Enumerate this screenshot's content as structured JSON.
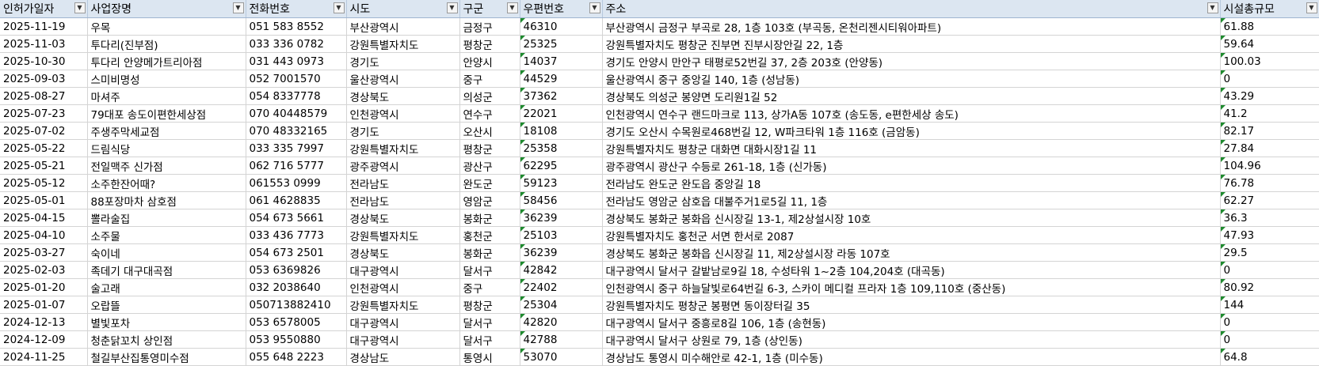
{
  "columns": [
    "인허가일자",
    "사업장명",
    "전화번호",
    "시도",
    "구군",
    "우편번호",
    "주소",
    "시설총규모"
  ],
  "rows": [
    [
      "2025-11-19",
      "우목",
      "051 583 8552",
      "부산광역시",
      "금정구",
      "46310",
      "부산광역시 금정구 부곡로 28, 1층 103호 (부곡동, 온천리젠시티워아파트)",
      "61.88"
    ],
    [
      "2025-11-03",
      "투다리(진부점)",
      "033 336 0782",
      "강원특별자치도",
      "평창군",
      "25325",
      "강원특별자치도 평창군 진부면 진부시장안길 22, 1층",
      "59.64"
    ],
    [
      "2025-10-30",
      "투다리 안양메가트리아점",
      "031 443 0973",
      "경기도",
      "안양시",
      "14037",
      "경기도 안양시 만안구 태평로52번길 37, 2층 203호 (안양동)",
      "100.03"
    ],
    [
      "2025-09-03",
      "스미비명성",
      "052 7001570",
      "울산광역시",
      "중구",
      "44529",
      "울산광역시 중구 중앙길 140, 1층 (성남동)",
      "0"
    ],
    [
      "2025-08-27",
      "마셔주",
      "054 8337778",
      "경상북도",
      "의성군",
      "37362",
      "경상북도 의성군 봉양면 도리원1길 52",
      "43.29"
    ],
    [
      "2025-07-23",
      "79대포 송도이편한세상점",
      "070 40448579",
      "인천광역시",
      "연수구",
      "22021",
      "인천광역시 연수구 랜드마크로 113, 상가A동 107호 (송도동, e편한세상 송도)",
      "41.2"
    ],
    [
      "2025-07-02",
      "주생주막세교점",
      "070 48332165",
      "경기도",
      "오산시",
      "18108",
      "경기도 오산시 수목원로468번길 12, W파크타워 1층 116호 (금암동)",
      "82.17"
    ],
    [
      "2025-05-22",
      "드림식당",
      "033 335 7997",
      "강원특별자치도",
      "평창군",
      "25358",
      "강원특별자치도 평창군 대화면 대화시장1길 11",
      "27.84"
    ],
    [
      "2025-05-21",
      "전일맥주 신가점",
      "062 716 5777",
      "광주광역시",
      "광산구",
      "62295",
      "광주광역시 광산구 수등로 261-18, 1층 (신가동)",
      "104.96"
    ],
    [
      "2025-05-12",
      "소주한잔어때?",
      "061553 0999",
      "전라남도",
      "완도군",
      "59123",
      "전라남도 완도군 완도읍 중앙길 18",
      "76.78"
    ],
    [
      "2025-05-01",
      "88포장마차 삼호점",
      "061 4628835",
      "전라남도",
      "영암군",
      "58456",
      "전라남도 영암군 삼호읍 대불주거1로5길 11, 1층",
      "62.27"
    ],
    [
      "2025-04-15",
      "뽈라술집",
      "054 673 5661",
      "경상북도",
      "봉화군",
      "36239",
      "경상북도 봉화군 봉화읍 신시장길 13-1, 제2상설시장 10호",
      "36.3"
    ],
    [
      "2025-04-10",
      "소주물",
      "033 436 7773",
      "강원특별자치도",
      "홍천군",
      "25103",
      "강원특별자치도 홍천군 서면 한서로 2087",
      "47.93"
    ],
    [
      "2025-03-27",
      "숙이네",
      "054 673 2501",
      "경상북도",
      "봉화군",
      "36239",
      "경상북도 봉화군 봉화읍 신시장길 11, 제2상설시장 라동 107호",
      "29.5"
    ],
    [
      "2025-02-03",
      "족데기 대구대곡점",
      "053 6369826",
      "대구광역시",
      "달서구",
      "42842",
      "대구광역시 달서구 갈밭남로9길 18, 수성타워 1~2층 104,204호 (대곡동)",
      "0"
    ],
    [
      "2025-01-20",
      "술고래",
      "032 2038640",
      "인천광역시",
      "중구",
      "22402",
      "인천광역시 중구 하늘달빛로64번길 6-3, 스카이 메디컬 프라자 1층 109,110호 (중산동)",
      "80.92"
    ],
    [
      "2025-01-07",
      "오랍뜰",
      "050713882410",
      "강원특별자치도",
      "평창군",
      "25304",
      "강원특별자치도 평창군 봉평면 동이장터길 35",
      "144"
    ],
    [
      "2024-12-13",
      "별빛포차",
      "053 6578005",
      "대구광역시",
      "달서구",
      "42820",
      "대구광역시 달서구 중흥로8길 106, 1층 (송현동)",
      "0"
    ],
    [
      "2024-12-09",
      "청춘닭꼬치 상인점",
      "053 9550880",
      "대구광역시",
      "달서구",
      "42788",
      "대구광역시 달서구 상원로 79, 1층 (상인동)",
      "0"
    ],
    [
      "2024-11-25",
      "철길부산집통영미수점",
      "055 648 2223",
      "경상남도",
      "통영시",
      "53070",
      "경상남도 통영시 미수해안로 42-1, 1층 (미수동)",
      "64.8"
    ]
  ]
}
